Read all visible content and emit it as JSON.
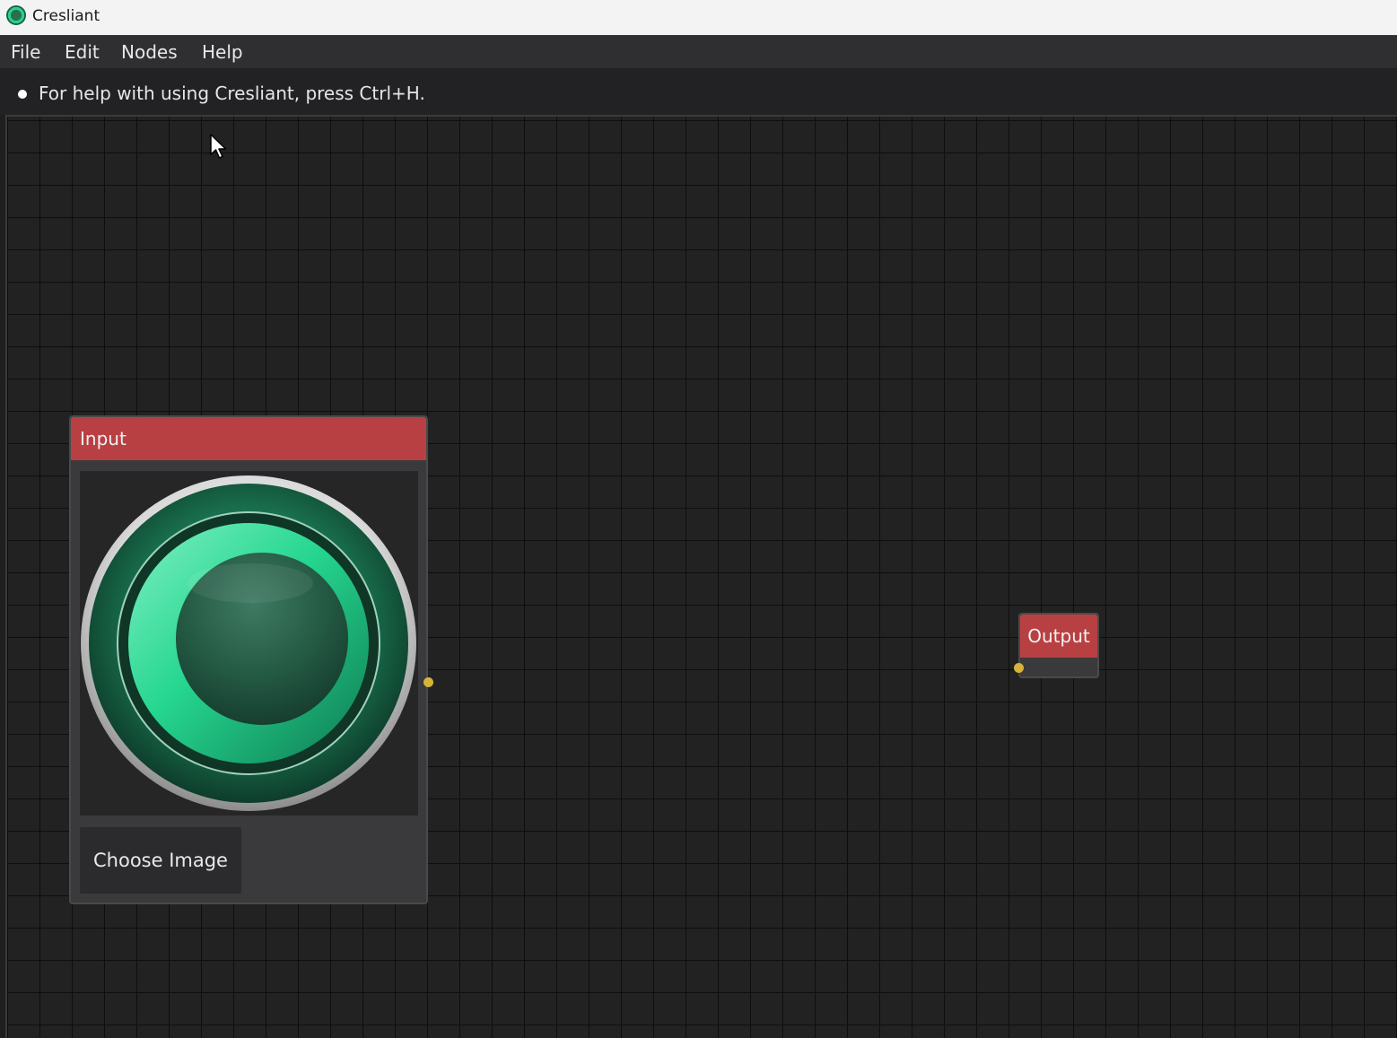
{
  "window": {
    "title": "Cresliant",
    "icon": "cresliant-logo-icon"
  },
  "menubar": {
    "items": [
      {
        "label": "File"
      },
      {
        "label": "Edit"
      },
      {
        "label": "Nodes"
      },
      {
        "label": "Help"
      }
    ]
  },
  "help_bar": {
    "text": "For help with using Cresliant, press Ctrl+H."
  },
  "nodes": {
    "input": {
      "title": "Input",
      "image": "cresliant-logo-image",
      "button_label": "Choose Image"
    },
    "output": {
      "title": "Output"
    }
  },
  "colors": {
    "node_header": "#b94042",
    "port": "#d6b43a",
    "canvas_bg": "#222222",
    "grid_line": "#0e0e0e",
    "menubar_bg": "#2f2f31"
  }
}
